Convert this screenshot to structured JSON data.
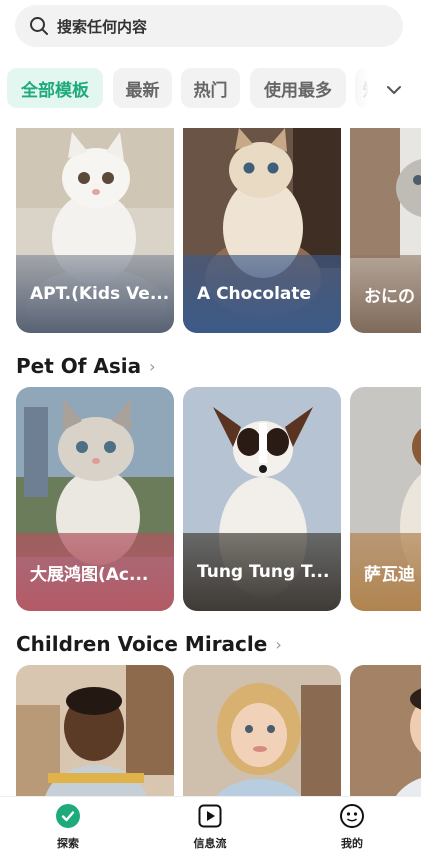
{
  "search": {
    "placeholder": "搜索任何内容",
    "icon": "search-icon"
  },
  "tabs": [
    {
      "label": "全部模板",
      "active": true
    },
    {
      "label": "最新",
      "active": false
    },
    {
      "label": "热门",
      "active": false
    },
    {
      "label": "使用最多",
      "active": false
    },
    {
      "label": "短",
      "active": false
    }
  ],
  "tabs_more_icon": "chevron-down-icon",
  "row1": {
    "cards": [
      {
        "title": "APT.(Kids Ve...",
        "subject": "white fluffy kitten"
      },
      {
        "title": "A Chocolate",
        "subject": "fluffy cream kitten"
      },
      {
        "title": "おにの",
        "subject": "tabby kitten"
      }
    ]
  },
  "sections": [
    {
      "title": "Pet Of Asia",
      "arrow": "›",
      "cards": [
        {
          "title": "大展鸿图(Ac...",
          "subject": "tabby kitten"
        },
        {
          "title": "Tung Tung T...",
          "subject": "papillon dog"
        },
        {
          "title": "萨瓦迪",
          "subject": "dog"
        }
      ]
    },
    {
      "title": "Children Voice Miracle",
      "arrow": "›",
      "cards": [
        {
          "title": "",
          "subject": "toddler boy"
        },
        {
          "title": "",
          "subject": "toddler girl"
        },
        {
          "title": "",
          "subject": "toddler"
        }
      ]
    }
  ],
  "bottom_nav": [
    {
      "label": "探索",
      "icon": "explore-icon",
      "active": true
    },
    {
      "label": "信息流",
      "icon": "feed-play-icon",
      "active": false
    },
    {
      "label": "我的",
      "icon": "profile-face-icon",
      "active": false
    }
  ],
  "colors": {
    "accent": "#1eab7c",
    "accent_bg": "#e3f6ef"
  }
}
